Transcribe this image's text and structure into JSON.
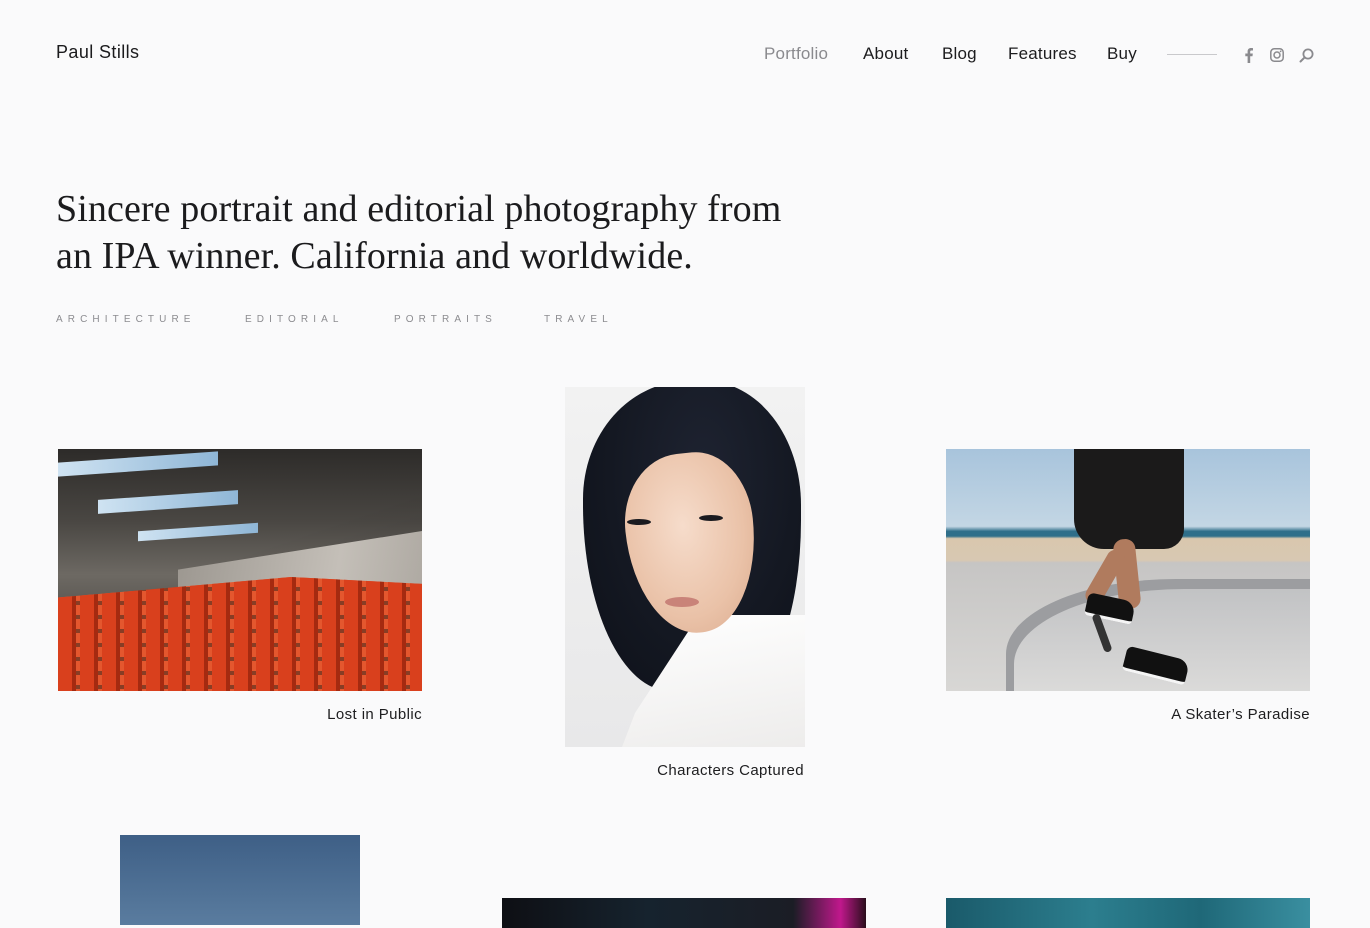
{
  "site": {
    "logo": "Paul Stills"
  },
  "nav": {
    "items": [
      {
        "label": "Portfolio",
        "active": true
      },
      {
        "label": "About",
        "active": false
      },
      {
        "label": "Blog",
        "active": false
      },
      {
        "label": "Features",
        "active": false
      },
      {
        "label": "Buy",
        "active": false
      }
    ],
    "social": [
      "facebook-icon",
      "instagram-icon",
      "search-icon"
    ]
  },
  "hero": {
    "line1": "Sincere portrait and editorial photography from",
    "line2": "an IPA winner. California and worldwide."
  },
  "categories": [
    "ARCHITECTURE",
    "EDITORIAL",
    "PORTRAITS",
    "TRAVEL"
  ],
  "portfolio": [
    {
      "caption": "Lost in Public",
      "image": "red stadium seats under concrete roof"
    },
    {
      "caption": "Characters Captured",
      "image": "portrait of woman with dark hair"
    },
    {
      "caption": "A Skater’s Paradise",
      "image": "skater at beach skatepark"
    }
  ],
  "colors": {
    "background": "#fafafb",
    "text": "#1d1d1f",
    "muted": "#8a8a8e",
    "divider": "#c9c9cc"
  }
}
